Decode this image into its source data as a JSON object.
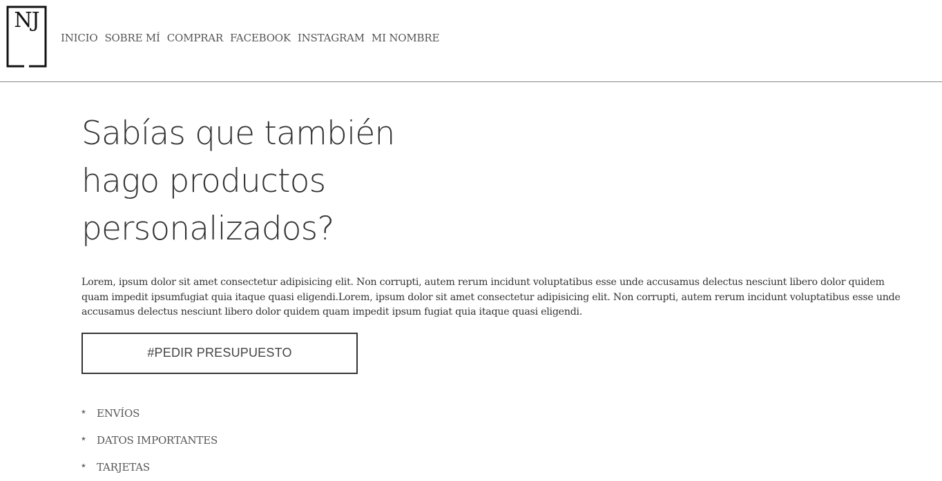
{
  "logo": {
    "text": "NJ"
  },
  "nav": {
    "items": [
      {
        "label": "INICIO"
      },
      {
        "label": "SOBRE MÍ"
      },
      {
        "label": "COMPRAR"
      },
      {
        "label": "FACEBOOK"
      },
      {
        "label": "INSTAGRAM"
      },
      {
        "label": "MI NOMBRE"
      }
    ]
  },
  "main": {
    "headline": [
      "Sabías que también",
      "hago productos",
      "personalizados?"
    ],
    "paragraph": "Lorem, ipsum dolor sit amet consectetur adipisicing elit. Non corrupti, autem rerum incidunt voluptatibus esse unde accusamus delectus nesciunt libero dolor quidem quam impedit ipsumfugiat quia itaque quasi eligendi.Lorem, ipsum dolor sit amet consectetur adipisicing elit. Non corrupti, autem rerum incidunt voluptatibus esse unde accusamus delectus nesciunt libero dolor quidem quam impedit ipsum fugiat quia itaque quasi eligendi.",
    "cta_label": "#PEDIR PRESUPUESTO",
    "bullet": "*",
    "links": [
      {
        "label": "ENVÍOS"
      },
      {
        "label": "DATOS IMPORTANTES"
      },
      {
        "label": "TARJETAS"
      }
    ]
  },
  "colors": {
    "text": "#333333",
    "nav_text": "#555555",
    "divider": "#888888",
    "background": "#ffffff"
  }
}
